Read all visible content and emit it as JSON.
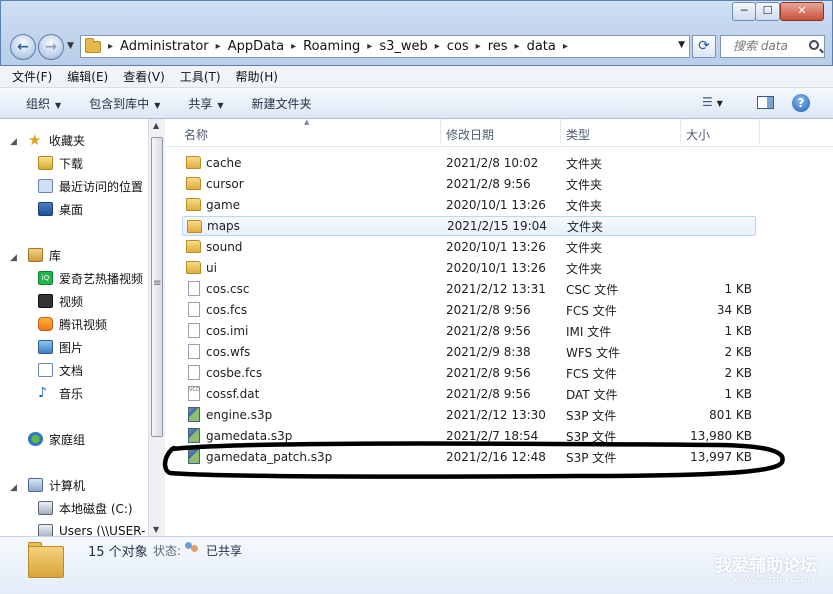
{
  "window": {
    "min_label": "─",
    "max_label": "☐",
    "close_label": "✕"
  },
  "address": {
    "crumbs": [
      "Administrator",
      "AppData",
      "Roaming",
      "s3_web",
      "cos",
      "res",
      "data"
    ],
    "search_placeholder": "搜索 data"
  },
  "menu": [
    "文件(F)",
    "编辑(E)",
    "查看(V)",
    "工具(T)",
    "帮助(H)"
  ],
  "toolbar": {
    "organize": "组织",
    "include_library": "包含到库中",
    "share": "共享",
    "new_folder": "新建文件夹"
  },
  "nav": {
    "favorites": "收藏夹",
    "downloads": "下载",
    "recent": "最近访问的位置",
    "desktop": "桌面",
    "libraries": "库",
    "iqiyi": "爱奇艺热播视频",
    "videos": "视频",
    "tencent_video": "腾讯视频",
    "pictures": "图片",
    "documents": "文档",
    "music": "音乐",
    "homegroup": "家庭组",
    "computer": "计算机",
    "local_disk": "本地磁盘 (C:)",
    "users_share": "Users (\\\\USER-"
  },
  "columns": {
    "name": "名称",
    "date": "修改日期",
    "type": "类型",
    "size": "大小"
  },
  "files": [
    {
      "name": "cache",
      "date": "2021/2/8 10:02",
      "type": "文件夹",
      "size": "",
      "kind": "folder"
    },
    {
      "name": "cursor",
      "date": "2021/2/8 9:56",
      "type": "文件夹",
      "size": "",
      "kind": "folder"
    },
    {
      "name": "game",
      "date": "2020/10/1 13:26",
      "type": "文件夹",
      "size": "",
      "kind": "folder"
    },
    {
      "name": "maps",
      "date": "2021/2/15 19:04",
      "type": "文件夹",
      "size": "",
      "kind": "folder",
      "selected": true
    },
    {
      "name": "sound",
      "date": "2020/10/1 13:26",
      "type": "文件夹",
      "size": "",
      "kind": "folder"
    },
    {
      "name": "ui",
      "date": "2020/10/1 13:26",
      "type": "文件夹",
      "size": "",
      "kind": "folder"
    },
    {
      "name": "cos.csc",
      "date": "2021/2/12 13:31",
      "type": "CSC 文件",
      "size": "1 KB",
      "kind": "file"
    },
    {
      "name": "cos.fcs",
      "date": "2021/2/8 9:56",
      "type": "FCS 文件",
      "size": "34 KB",
      "kind": "file"
    },
    {
      "name": "cos.imi",
      "date": "2021/2/8 9:56",
      "type": "IMI 文件",
      "size": "1 KB",
      "kind": "file"
    },
    {
      "name": "cos.wfs",
      "date": "2021/2/9 8:38",
      "type": "WFS 文件",
      "size": "2 KB",
      "kind": "file"
    },
    {
      "name": "cosbe.fcs",
      "date": "2021/2/8 9:56",
      "type": "FCS 文件",
      "size": "2 KB",
      "kind": "file"
    },
    {
      "name": "cossf.dat",
      "date": "2021/2/8 9:56",
      "type": "DAT 文件",
      "size": "1 KB",
      "kind": "vcd"
    },
    {
      "name": "engine.s3p",
      "date": "2021/2/12 13:30",
      "type": "S3P 文件",
      "size": "801 KB",
      "kind": "s3p"
    },
    {
      "name": "gamedata.s3p",
      "date": "2021/2/7 18:54",
      "type": "S3P 文件",
      "size": "13,980 KB",
      "kind": "s3p"
    },
    {
      "name": "gamedata_patch.s3p",
      "date": "2021/2/16 12:48",
      "type": "S3P 文件",
      "size": "13,997 KB",
      "kind": "s3p"
    }
  ],
  "details": {
    "count": "15 个对象",
    "state_label": "状态:",
    "state": "已共享"
  },
  "watermark": {
    "title": "我爱辅助论坛",
    "url": "www.52fzba.com"
  }
}
